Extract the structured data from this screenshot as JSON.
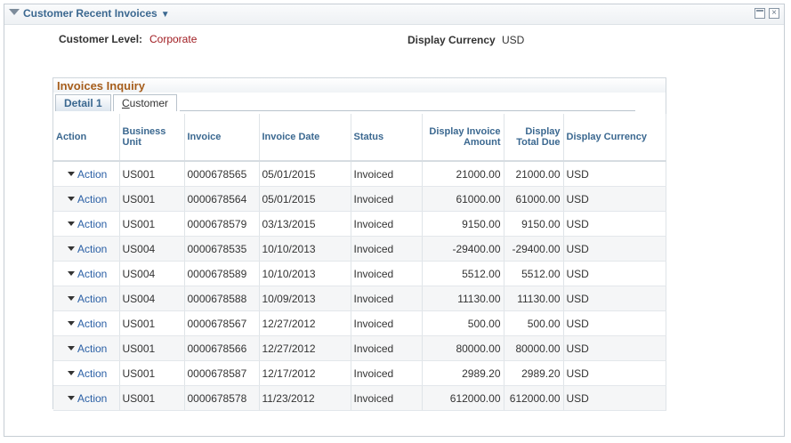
{
  "pagelet": {
    "title": "Customer Recent Invoices",
    "menu_arrow": "▼",
    "close_glyph": "×"
  },
  "fields": {
    "customer_level_label": "Customer Level:",
    "customer_level_value": "Corporate",
    "display_currency_label": "Display Currency",
    "display_currency_value": "USD"
  },
  "grid": {
    "title": "Invoices Inquiry",
    "tabs": [
      {
        "label": "Detail 1",
        "active": true
      },
      {
        "label_first": "C",
        "label_rest": "ustomer",
        "active": false
      }
    ],
    "columns": {
      "action": "Action",
      "business_unit": "Business Unit",
      "invoice": "Invoice",
      "invoice_date": "Invoice Date",
      "status": "Status",
      "display_invoice_amount": "Display Invoice Amount",
      "display_total_due": "Display Total Due",
      "display_currency": "Display Currency"
    },
    "rows": [
      {
        "action": "Action",
        "bu": "US001",
        "invoice": "0000678565",
        "date": "05/01/2015",
        "status": "Invoiced",
        "amount": "21000.00",
        "due": "21000.00",
        "currency": "USD"
      },
      {
        "action": "Action",
        "bu": "US001",
        "invoice": "0000678564",
        "date": "05/01/2015",
        "status": "Invoiced",
        "amount": "61000.00",
        "due": "61000.00",
        "currency": "USD"
      },
      {
        "action": "Action",
        "bu": "US001",
        "invoice": "0000678579",
        "date": "03/13/2015",
        "status": "Invoiced",
        "amount": "9150.00",
        "due": "9150.00",
        "currency": "USD"
      },
      {
        "action": "Action",
        "bu": "US004",
        "invoice": "0000678535",
        "date": "10/10/2013",
        "status": "Invoiced",
        "amount": "-29400.00",
        "due": "-29400.00",
        "currency": "USD"
      },
      {
        "action": "Action",
        "bu": "US004",
        "invoice": "0000678589",
        "date": "10/10/2013",
        "status": "Invoiced",
        "amount": "5512.00",
        "due": "5512.00",
        "currency": "USD"
      },
      {
        "action": "Action",
        "bu": "US004",
        "invoice": "0000678588",
        "date": "10/09/2013",
        "status": "Invoiced",
        "amount": "11130.00",
        "due": "11130.00",
        "currency": "USD"
      },
      {
        "action": "Action",
        "bu": "US001",
        "invoice": "0000678567",
        "date": "12/27/2012",
        "status": "Invoiced",
        "amount": "500.00",
        "due": "500.00",
        "currency": "USD"
      },
      {
        "action": "Action",
        "bu": "US001",
        "invoice": "0000678566",
        "date": "12/27/2012",
        "status": "Invoiced",
        "amount": "80000.00",
        "due": "80000.00",
        "currency": "USD"
      },
      {
        "action": "Action",
        "bu": "US001",
        "invoice": "0000678587",
        "date": "12/17/2012",
        "status": "Invoiced",
        "amount": "2989.20",
        "due": "2989.20",
        "currency": "USD"
      },
      {
        "action": "Action",
        "bu": "US001",
        "invoice": "0000678578",
        "date": "11/23/2012",
        "status": "Invoiced",
        "amount": "612000.00",
        "due": "612000.00",
        "currency": "USD"
      }
    ]
  },
  "colors": {
    "title_blue": "#3b6890",
    "level_red": "#a01c21",
    "grid_title_orange": "#a65d1b",
    "link_blue": "#2a5fa5"
  },
  "icons": [
    "collapse-triangle-icon",
    "maximize-icon",
    "close-icon",
    "dropdown-arrow-icon"
  ]
}
